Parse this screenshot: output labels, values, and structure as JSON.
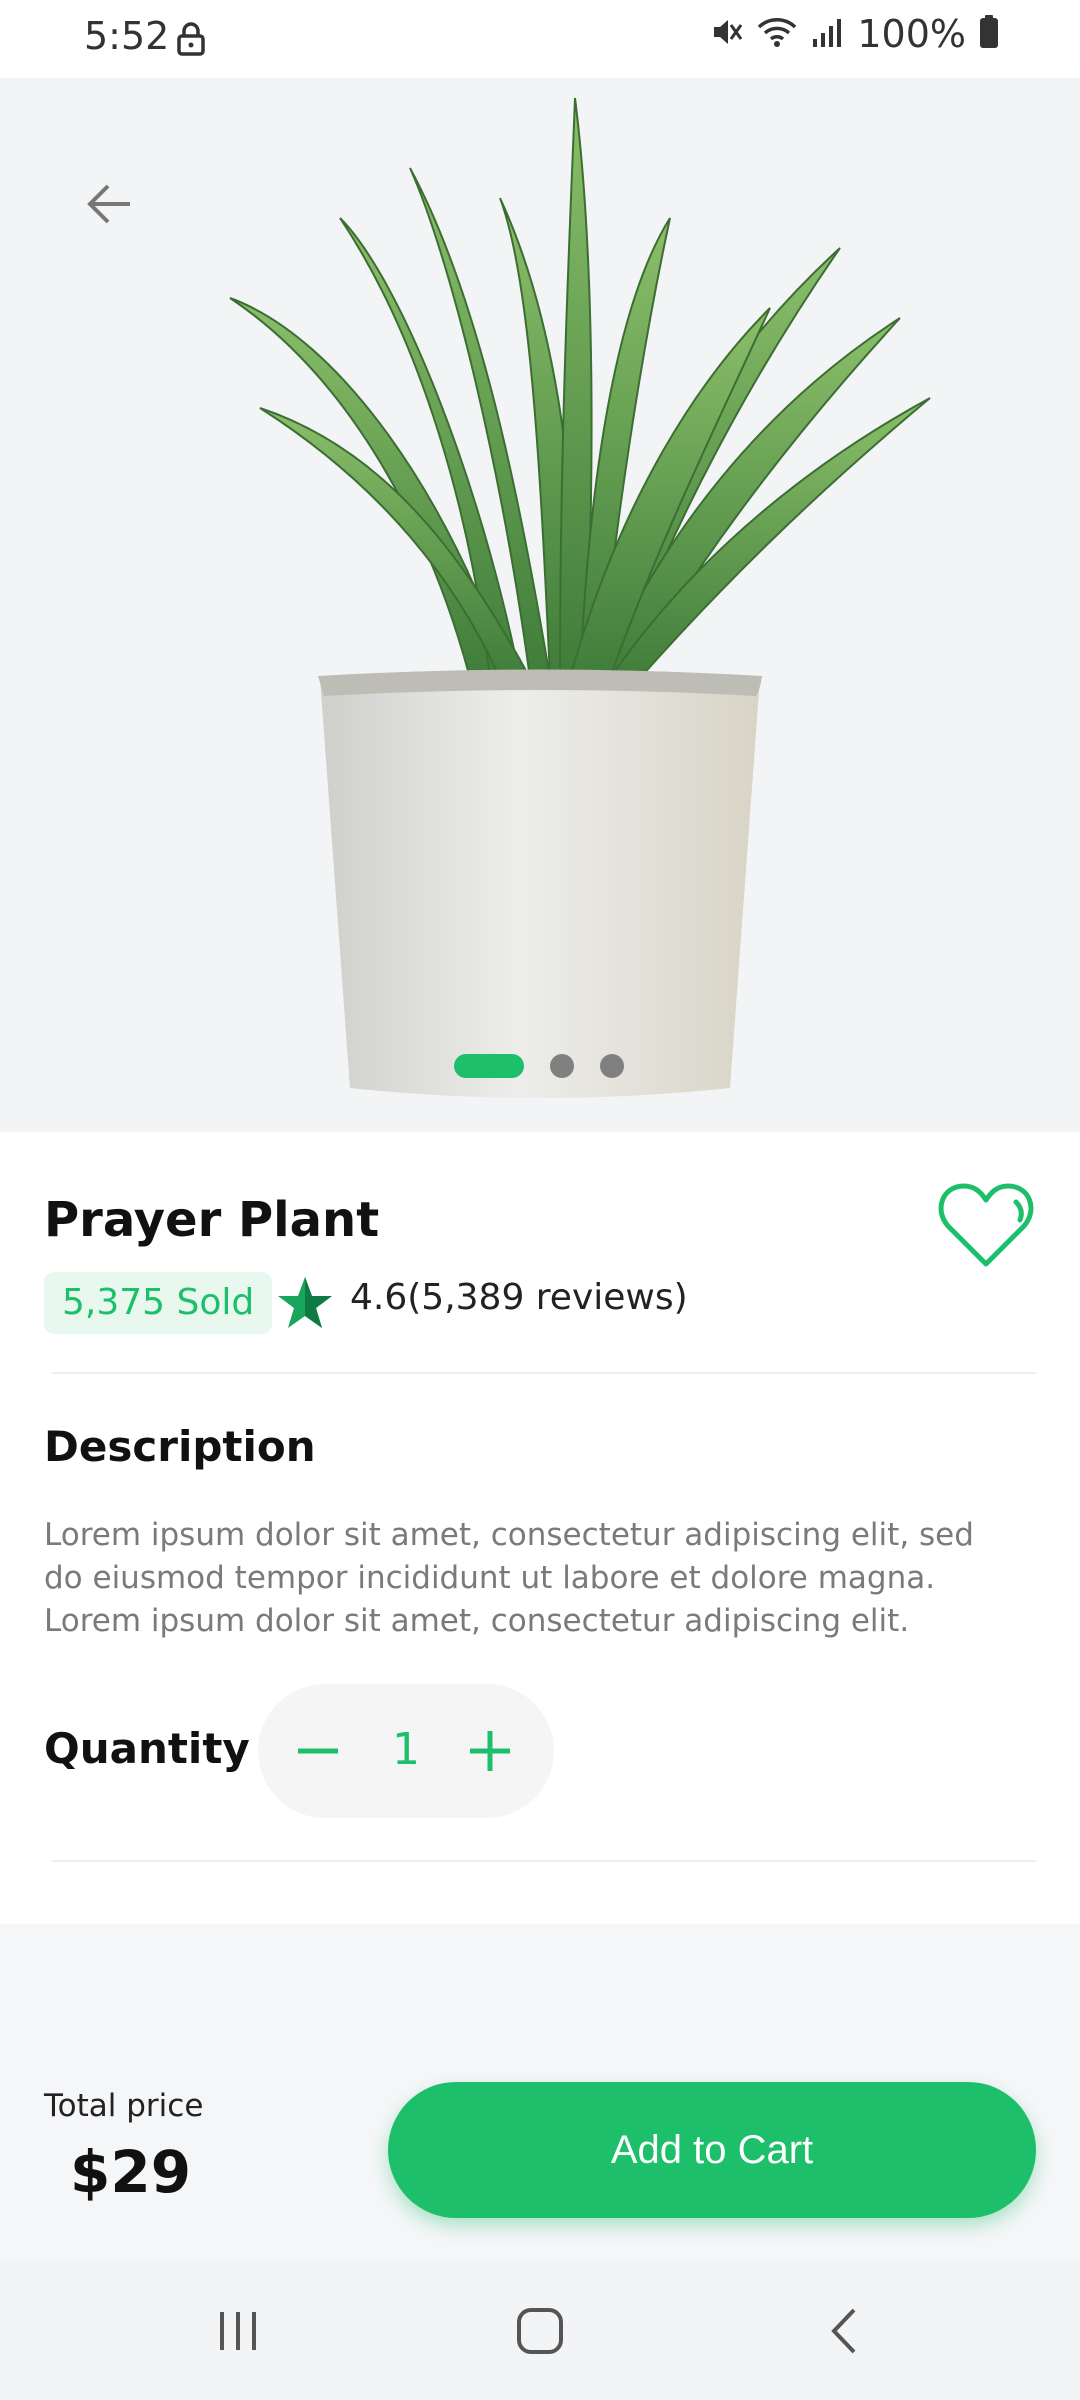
{
  "status_bar": {
    "time": "5:52",
    "battery": "100%"
  },
  "product": {
    "title": "Prayer Plant",
    "sold": "5,375 Sold",
    "rating": "4.6(5,389 reviews)",
    "carousel": {
      "active_index": 0,
      "count": 3
    }
  },
  "description": {
    "heading": "Description",
    "text": "Lorem ipsum dolor sit amet, consectetur adipiscing elit, sed do eiusmod tempor incididunt ut labore et dolore magna. Lorem ipsum dolor sit amet, consectetur adipiscing elit."
  },
  "quantity": {
    "label": "Quantity",
    "value": "1"
  },
  "checkout": {
    "total_label": "Total price",
    "total_value": "$29",
    "add_to_cart_label": "Add to Cart"
  },
  "icons": {
    "back": "arrow-left-icon",
    "favorite": "heart-outline-icon",
    "rating_star": "star-icon",
    "minus": "minus-icon",
    "plus": "plus-icon"
  },
  "colors": {
    "accent": "#1dbf6a",
    "badge_bg": "#e9f8ef"
  }
}
